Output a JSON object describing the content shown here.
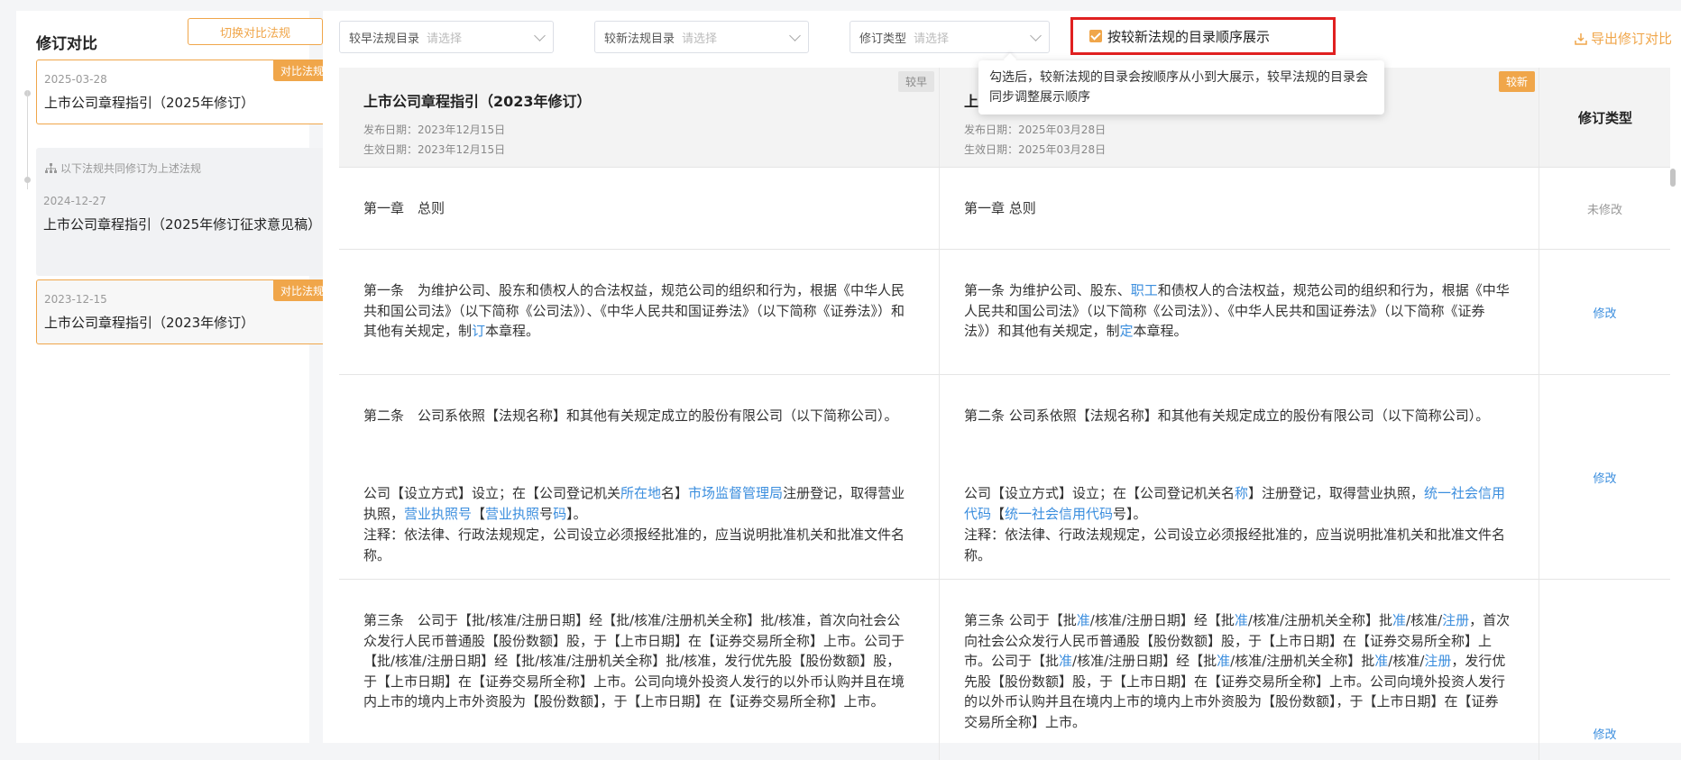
{
  "sidebar": {
    "title": "修订对比",
    "switch_button": "切换对比法规",
    "shared_label": "以下法规共同修订为上述法规",
    "cards": [
      {
        "date": "2025-03-28",
        "name": "上市公司章程指引（2025年修订）",
        "tag": "对比法规"
      },
      {
        "date": "2024-12-27",
        "name": "上市公司章程指引（2025年修订征求意见稿）",
        "tag": ""
      },
      {
        "date": "2023-12-15",
        "name": "上市公司章程指引（2023年修订）",
        "tag": "对比法规"
      }
    ]
  },
  "filters": [
    {
      "label": "较早法规目录",
      "placeholder": "请选择"
    },
    {
      "label": "较新法规目录",
      "placeholder": "请选择"
    },
    {
      "label": "修订类型",
      "placeholder": "请选择"
    }
  ],
  "checkbox_label": "按较新法规的目录顺序展示",
  "export_label": "导出修订对比",
  "tooltip": "勾选后，较新法规的目录会按顺序从小到大展示，较早法规的目录会同步调整展示顺序",
  "header": {
    "old": {
      "title": "上市公司章程指引（2023年修订）",
      "publish": "发布日期：2023年12月15日",
      "effective": "生效日期：2023年12月15日",
      "badge": "较早"
    },
    "new": {
      "title": "上",
      "publish": "发布日期：2025年03月28日",
      "effective": "生效日期：2025年03月28日",
      "badge": "较新"
    },
    "type_col": "修订类型"
  },
  "rows": [
    {
      "old": [
        "第一章　总则"
      ],
      "new": [
        "第一章 总则"
      ],
      "type": "未修改"
    },
    {
      "old": [
        "第一条　为维护公司、股东和债权人的合法权益，规范公司的组织和行为，根据《中华人民共和国公司法》（以下简称《公司法》）、《中华人民共和国证券法》（以下简称《证券法》）和其他有关规定，制",
        "订",
        "本章程。"
      ],
      "new": [
        "第一条 为维护公司、股东、",
        "职工",
        "和债权人的合法权益，规范公司的组织和行为，根据《中华人民共和国公司法》（以下简称《公司法》）、《中华人民共和国证券法》（以下简称《证券法》）和其他有关规定，制",
        "定",
        "本章程。"
      ],
      "type": "修改"
    },
    {
      "old_p1": "第二条　公司系依照【法规名称】和其他有关规定成立的股份有限公司（以下简称公司）。",
      "old_p2": [
        " 公司【设立方式】设立；在【公司登记机关",
        "所在地",
        "名】",
        "市场监督管理局",
        "注册登记，取得营业执照，",
        "营业执照号",
        "【",
        "营业执照",
        "号",
        "码",
        "】。"
      ],
      "old_p3": "注释：依法律、行政法规规定，公司设立必须报经批准的，应当说明批准机关和批准文件名称。",
      "new_p1": "第二条 公司系依照【法规名称】和其他有关规定成立的股份有限公司（以下简称公司）。",
      "new_p2": [
        "公司【设立方式】设立；在【公司登记机关名",
        "称",
        "】注册登记，取得营业执照，",
        "统一社会信用代码",
        "【",
        "统一社会信用代码",
        "号】。"
      ],
      "new_p3": "注释：依法律、行政法规规定，公司设立必须报经批准的，应当说明批准机关和批准文件名称。",
      "type": "修改"
    },
    {
      "old": "第三条　公司于【批/核准/注册日期】经【批/核准/注册机关全称】批/核准，首次向社会公众发行人民币普通股【股份数额】股，于【上市日期】在【证券交易所全称】上市。公司于【批/核准/注册日期】经【批/核准/注册机关全称】批/核准，发行优先股【股份数额】股，于【上市日期】在【证券交易所全称】上市。公司向境外投资人发行的以外币认购并且在境内上市的境内上市外资股为【股份数额】，于【上市日期】在【证券交易所全称】上市。",
      "new": [
        "第三条 公司于【批",
        "准",
        "/核准/注册日期】经【批",
        "准",
        "/核准/注册机关全称】批",
        "准",
        "/核准/",
        "注册",
        "，首次向社会公众发行人民币普通股【股份数额】股，于【上市日期】在【证券交易所全称】上市。公司于【批",
        "准",
        "/核准/注册日期】经【批",
        "准",
        "/核准/注册机关全称】批",
        "准",
        "/核准/",
        "注册",
        "，发行优先股【股份数额】股，于【上市日期】在【证券交易所全称】上市。公司向境外投资人发行的以外币认购并且在境内上市的境内上市外资股为【股份数额】，于【上市日期】在【证券交易所全称】上市。"
      ],
      "type": "修改"
    }
  ],
  "colors": {
    "accent": "#f0a64a",
    "link": "#3b8ede",
    "highlight_border": "#e02020"
  }
}
